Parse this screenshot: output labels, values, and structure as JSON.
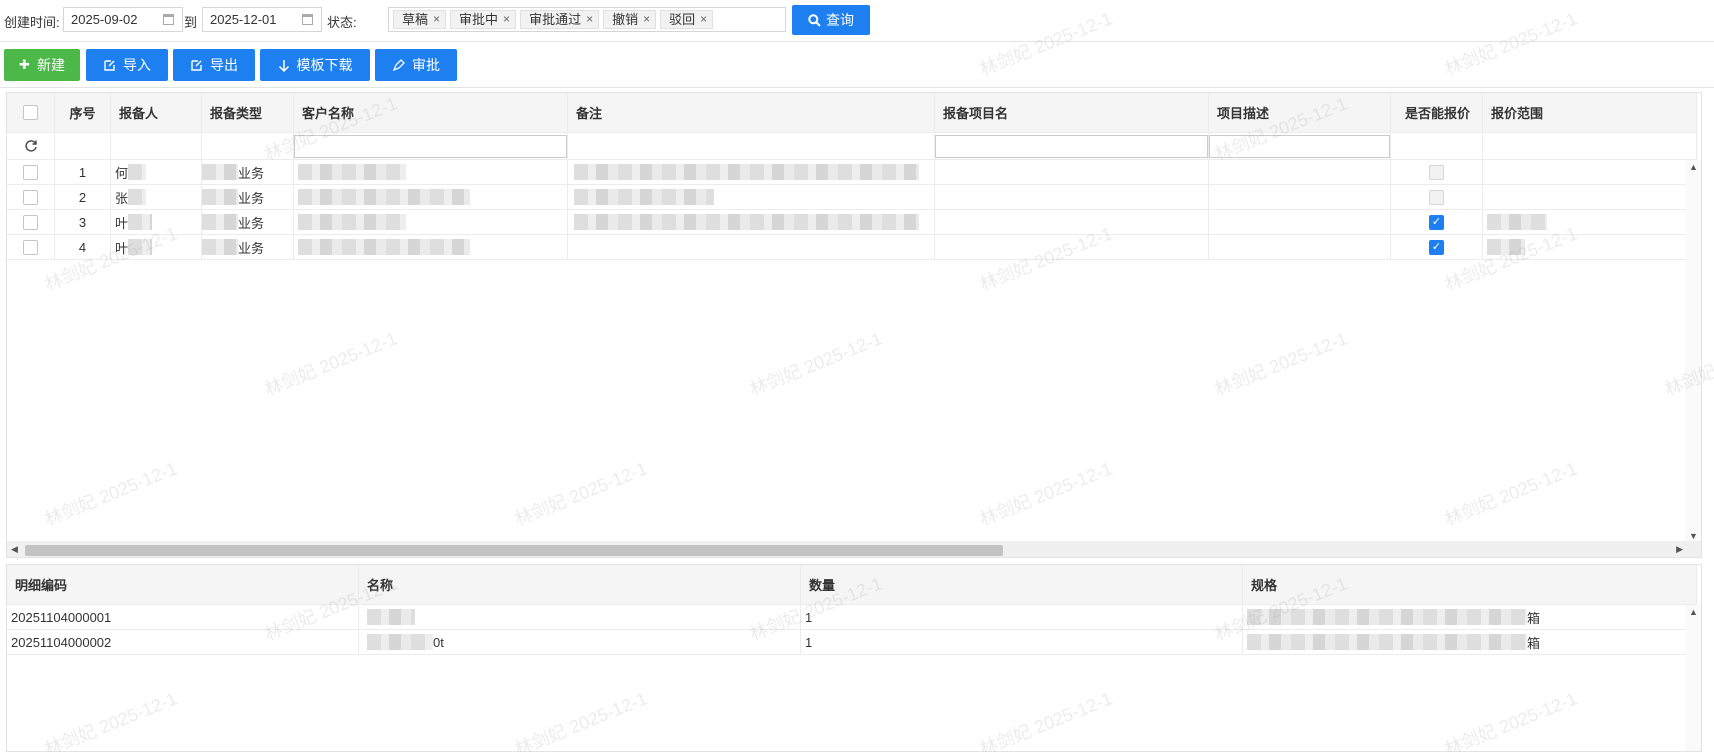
{
  "filter": {
    "created_label": "创建时间:",
    "start_date": "2025-09-02",
    "to_label": "到",
    "end_date": "2025-12-01",
    "status_label": "状态:",
    "status_tags": [
      "草稿",
      "审批中",
      "审批通过",
      "撤销",
      "驳回"
    ],
    "query_label": "查询"
  },
  "toolbar": {
    "new_label": "新建",
    "import_label": "导入",
    "export_label": "导出",
    "template_label": "模板下载",
    "approve_label": "审批"
  },
  "main_grid": {
    "columns": [
      "序号",
      "报备人",
      "报备类型",
      "客户名称",
      "备注",
      "报备项目名",
      "项目描述",
      "是否能报价",
      "报价范围"
    ],
    "rows": [
      {
        "index": "1",
        "reporter": "何",
        "type": "业务",
        "can_quote": false
      },
      {
        "index": "2",
        "reporter": "张",
        "type": "业务",
        "can_quote": false
      },
      {
        "index": "3",
        "reporter": "叶",
        "type": "业务",
        "can_quote": true
      },
      {
        "index": "4",
        "reporter": "叶",
        "type": "业务",
        "can_quote": true
      }
    ]
  },
  "detail_grid": {
    "columns": [
      "明细编码",
      "名称",
      "数量",
      "规格"
    ],
    "rows": [
      {
        "code": "20251104000001",
        "name": "",
        "qty": "1",
        "spec_suffix": "箱"
      },
      {
        "code": "20251104000002",
        "name": "0t",
        "qty": "1",
        "spec_suffix": "箱"
      }
    ]
  },
  "watermark": "林剑妃 2025-12-1",
  "colors": {
    "primary": "#1e7ff0",
    "success": "#4cb848"
  }
}
